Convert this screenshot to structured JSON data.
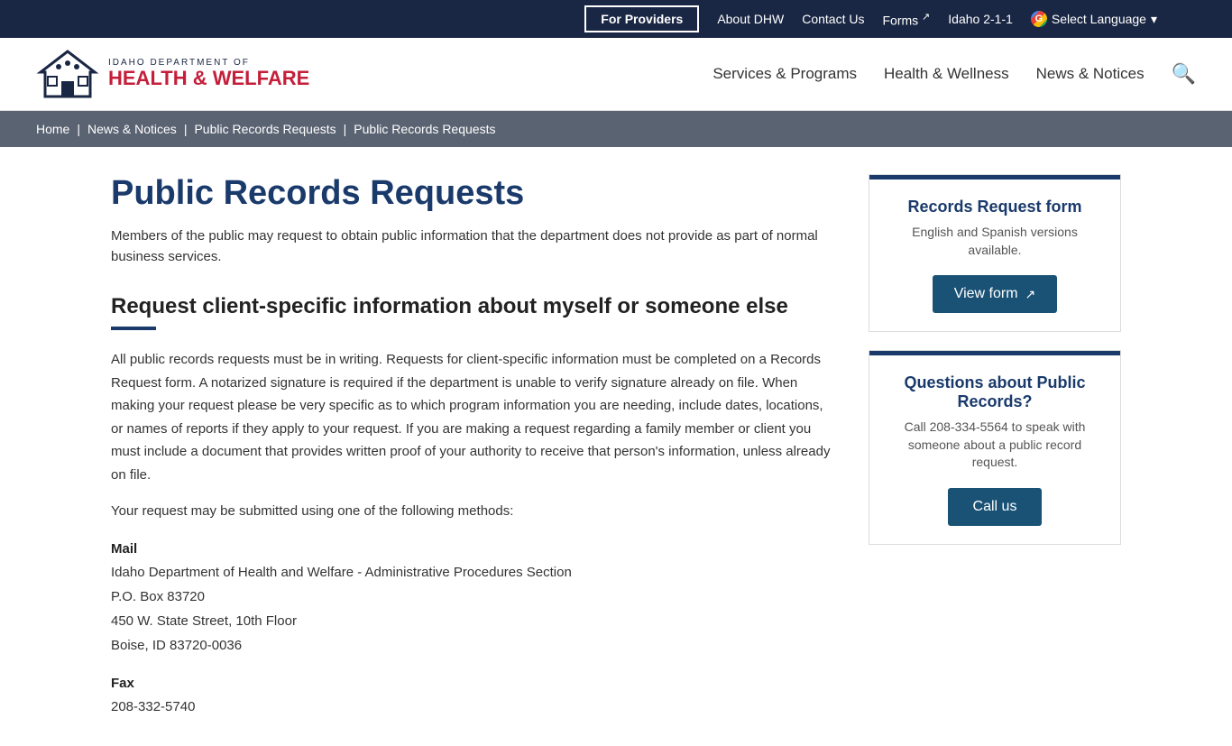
{
  "topbar": {
    "for_providers": "For Providers",
    "about_dhw": "About DHW",
    "contact_us": "Contact Us",
    "forms": "Forms",
    "idaho_211": "Idaho 2-1-1",
    "select_language": "Select Language"
  },
  "header": {
    "logo_top": "IDAHO DEPARTMENT OF",
    "logo_health": "HEALTH",
    "logo_ampersand": "&",
    "logo_welfare": "WELFARE",
    "nav": {
      "services": "Services & Programs",
      "health": "Health & Wellness",
      "news": "News & Notices"
    }
  },
  "breadcrumb": {
    "home": "Home",
    "news": "News & Notices",
    "public1": "Public Records Requests",
    "public2": "Public Records Requests"
  },
  "page": {
    "title": "Public Records Requests",
    "intro": "Members of the public may request to obtain public information that the department does not provide as part of normal business services.",
    "section_heading": "Request client-specific information about myself or someone else",
    "body1": "All public records requests must be in writing. Requests for client-specific information must be completed on a Records Request form. A notarized signature is required if the department is unable to verify signature already on file. When making your request please be very specific as to which program information you are needing, include dates, locations, or names of reports if they apply to your request. If you are making a request regarding a family member or client you must include a document that provides written proof of your authority to receive that person's information, unless already on file.",
    "body2": "Your request may be submitted using one of the following methods:",
    "mail_label": "Mail",
    "mail_line1": "Idaho Department of Health and Welfare - Administrative Procedures Section",
    "mail_line2": "P.O. Box 83720",
    "mail_line3": "450 W. State Street, 10th Floor",
    "mail_line4": "Boise, ID 83720-0036",
    "fax_label": "Fax",
    "fax_number": "208-332-5740"
  },
  "sidebar": {
    "card1": {
      "title": "Records Request form",
      "desc": "English and Spanish versions available.",
      "btn": "View form"
    },
    "card2": {
      "title": "Questions about Public Records?",
      "desc": "Call 208-334-5564 to speak with someone about a public record request.",
      "btn": "Call us"
    }
  }
}
